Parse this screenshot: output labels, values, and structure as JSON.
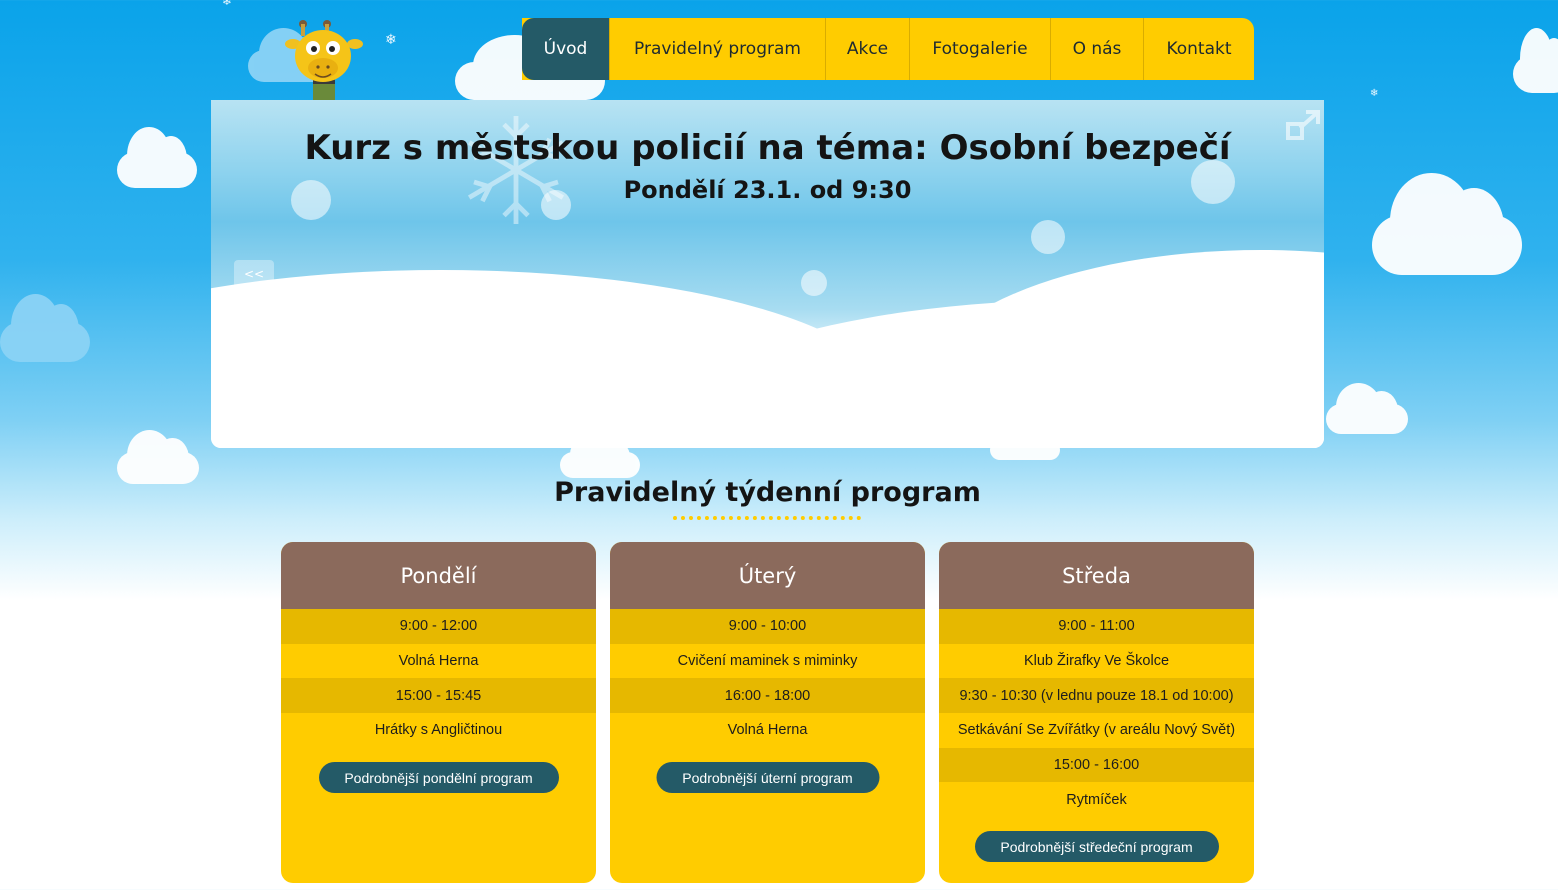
{
  "nav": {
    "items": [
      {
        "label": "Úvod",
        "active": true
      },
      {
        "label": "Pravidelný program",
        "active": false
      },
      {
        "label": "Akce",
        "active": false
      },
      {
        "label": "Fotogalerie",
        "active": false
      },
      {
        "label": "O nás",
        "active": false
      },
      {
        "label": "Kontakt",
        "active": false
      }
    ]
  },
  "slider": {
    "title": "Kurz s městskou policií na téma: Osobní bezpečí",
    "subtitle": "Pondělí 23.1. od 9:30",
    "prev_label": "<<",
    "next_label": ">>"
  },
  "section": {
    "title": "Pravidelný týdenní program"
  },
  "days": [
    {
      "name": "Pondělí",
      "rows": [
        "9:00 - 12:00",
        "Volná Herna",
        "15:00 - 15:45",
        "Hrátky s Angličtinou"
      ],
      "button": "Podrobnější pondělní program"
    },
    {
      "name": "Úterý",
      "rows": [
        "9:00 - 10:00",
        "Cvičení maminek s miminky",
        "16:00 - 18:00",
        "Volná Herna"
      ],
      "button": "Podrobnější úterní program"
    },
    {
      "name": "Středa",
      "rows": [
        "9:00 - 11:00",
        "Klub Žirafky Ve Školce",
        "9:30 - 10:30 (v lednu pouze 18.1 od 10:00)",
        "Setkávání Se Zvířátky (v areálu Nový Svět)",
        "15:00 - 16:00",
        "Rytmíček"
      ],
      "button": "Podrobnější středeční program"
    }
  ],
  "colors": {
    "accent_yellow": "#ffcc00",
    "dark_teal": "#245a67",
    "brown": "#8b6a5c"
  }
}
